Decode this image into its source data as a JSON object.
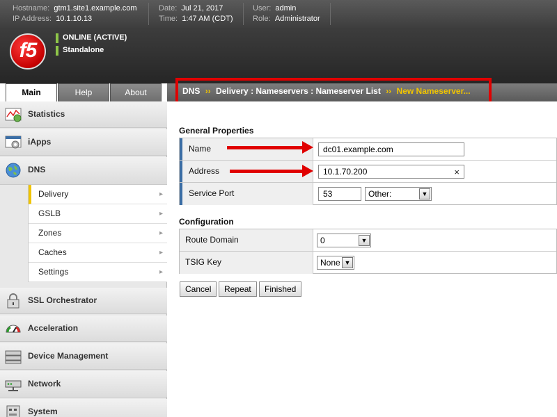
{
  "topbar": {
    "hostname_label": "Hostname:",
    "hostname": "gtm1.site1.example.com",
    "ip_label": "IP Address:",
    "ip": "10.1.10.13",
    "date_label": "Date:",
    "date": "Jul 21, 2017",
    "time_label": "Time:",
    "time": "1:47 AM (CDT)",
    "user_label": "User:",
    "user": "admin",
    "role_label": "Role:",
    "role": "Administrator"
  },
  "header": {
    "logo_text": "f5",
    "status": "ONLINE (ACTIVE)",
    "mode": "Standalone",
    "status_color": "#8fc649"
  },
  "tabs": [
    {
      "label": "Main",
      "active": true
    },
    {
      "label": "Help",
      "active": false
    },
    {
      "label": "About",
      "active": false
    }
  ],
  "breadcrumb": {
    "root": "DNS",
    "sep": "››",
    "path": "Delivery : Nameservers : Nameserver List",
    "current": "New Nameserver..."
  },
  "sidebar": {
    "items": [
      {
        "label": "Statistics",
        "icon": "statistics-icon"
      },
      {
        "label": "iApps",
        "icon": "iapps-icon"
      },
      {
        "label": "DNS",
        "icon": "globe-icon"
      },
      {
        "label": "SSL Orchestrator",
        "icon": "lock-icon"
      },
      {
        "label": "Acceleration",
        "icon": "gauge-icon"
      },
      {
        "label": "Device Management",
        "icon": "server-icon"
      },
      {
        "label": "Network",
        "icon": "network-icon"
      },
      {
        "label": "System",
        "icon": "system-icon"
      }
    ],
    "dns_sub": [
      {
        "label": "Delivery",
        "active": true
      },
      {
        "label": "GSLB",
        "active": false
      },
      {
        "label": "Zones",
        "active": false
      },
      {
        "label": "Caches",
        "active": false
      },
      {
        "label": "Settings",
        "active": false
      }
    ]
  },
  "general": {
    "title": "General Properties",
    "name_label": "Name",
    "name_value": "dc01.example.com",
    "address_label": "Address",
    "address_value": "10.1.70.200",
    "address_clear": "×",
    "port_label": "Service Port",
    "port_value": "53",
    "port_select": "Other:"
  },
  "configuration": {
    "title": "Configuration",
    "route_label": "Route Domain",
    "route_value": "0",
    "tsig_label": "TSIG Key",
    "tsig_value": "None"
  },
  "buttons": {
    "cancel": "Cancel",
    "repeat": "Repeat",
    "finished": "Finished"
  },
  "colors": {
    "accent_yellow": "#f0c400",
    "annotation_red": "#e00000",
    "row_marker_blue": "#3b6ea5"
  }
}
